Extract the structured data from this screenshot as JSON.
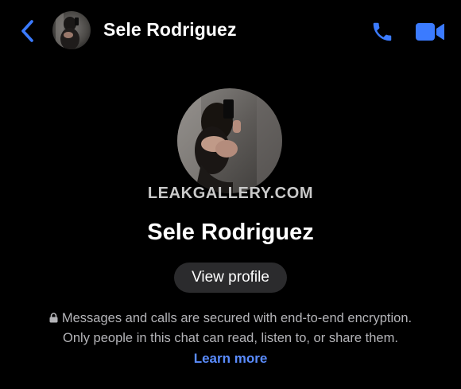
{
  "colors": {
    "background": "#000000",
    "accent": "#3b7bff",
    "link": "#5a8cff",
    "pill_background": "#2b2b2d",
    "secondary_text": "#b4b4b8"
  },
  "header": {
    "back_icon": "chevron-left-icon",
    "avatar_icon": "contact-photo",
    "name": "Sele Rodriguez",
    "call_icon": "phone-icon",
    "video_icon": "video-camera-icon"
  },
  "profile": {
    "avatar_icon": "contact-photo",
    "watermark": "LEAKGALLERY.COM",
    "name": "Sele Rodriguez",
    "view_profile_label": "View profile"
  },
  "encryption": {
    "lock_icon": "lock-icon",
    "line1": "Messages and calls are secured with end-to-end encryption.",
    "line2": "Only people in this chat can read, listen to, or share them.",
    "learn_more": "Learn more"
  }
}
